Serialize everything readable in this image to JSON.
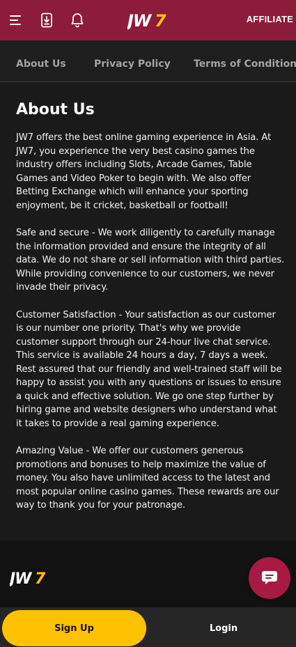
{
  "header": {
    "logo_text": "JW7",
    "affiliate_label": "AFFILIATE",
    "icons": [
      "menu-icon",
      "download-icon",
      "bell-icon"
    ],
    "background_color": "#8c1c3a"
  },
  "subnav": {
    "items": [
      {
        "label": "About Us"
      },
      {
        "label": "Privacy Policy"
      },
      {
        "label": "Terms of Conditions"
      }
    ]
  },
  "main": {
    "title": "About Us",
    "paragraphs": [
      "JW7 offers the best online gaming experience in Asia. At JW7, you experience the very best casino games the industry offers including Slots, Arcade Games, Table Games and Video Poker to begin with. We also offer Betting Exchange which will enhance your sporting enjoyment, be it cricket, basketball or football!",
      "Safe and secure - We work diligently to carefully manage the information provided and ensure the integrity of all data. We do not share or sell information with third parties. While providing convenience to our customers, we never invade their privacy.",
      "Customer Satisfaction - Your satisfaction as our customer is our number one priority. That's why we provide customer support through our 24-hour live chat service. This service is available 24 hours a day, 7 days a week. Rest assured that our friendly and well-trained staff will be happy to assist you with any questions or issues to ensure a quick and effective solution. We go one step further by hiring game and website designers who understand what it takes to provide a real gaming experience.",
      "Amazing Value - We offer our customers generous promotions and bonuses to help maximize the value of money. You also have unlimited access to the latest and most popular online casino games. These rewards are our way to thank you for your patronage."
    ]
  },
  "footer": {
    "logo_text": "JW7",
    "chat_icon": "chat-icon"
  },
  "bottom_bar": {
    "signup_label": "Sign Up",
    "login_label": "Login",
    "signup_color": "#ffc200"
  }
}
